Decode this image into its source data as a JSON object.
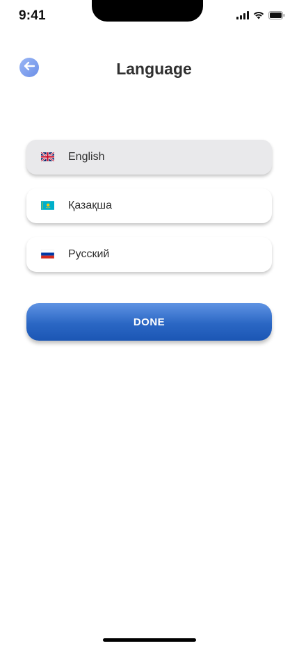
{
  "status_bar": {
    "time": "9:41",
    "icons": [
      "cellular-signal-icon",
      "wifi-icon",
      "battery-icon"
    ]
  },
  "header": {
    "title": "Language",
    "back_icon": "arrow-left-icon"
  },
  "languages": [
    {
      "label": "English",
      "flag_icon": "uk-flag-icon",
      "selected": true
    },
    {
      "label": "Қазақша",
      "flag_icon": "kazakhstan-flag-icon",
      "selected": false
    },
    {
      "label": "Русский",
      "flag_icon": "russia-flag-icon",
      "selected": false
    }
  ],
  "done_button": {
    "label": "DONE"
  },
  "colors": {
    "accent": "#2b67c4",
    "back_button": "#7d9ff0",
    "selected_row": "#e9e9eb",
    "title_text": "#2f2f2f"
  }
}
